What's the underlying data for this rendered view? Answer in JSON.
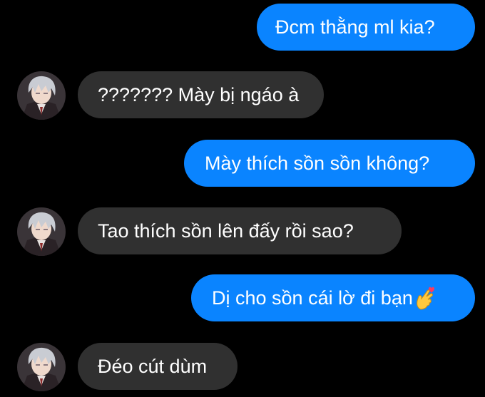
{
  "conversation": {
    "colors": {
      "background": "#000000",
      "outgoing_bubble": "#0a84ff",
      "incoming_bubble": "#303030",
      "text": "#ffffff"
    },
    "messages": [
      {
        "direction": "outgoing",
        "text": "Đcm thằng ml kia?"
      },
      {
        "direction": "incoming",
        "text": "??????? Mày bị ngáo à",
        "avatar": "anime-avatar"
      },
      {
        "direction": "outgoing",
        "text": "Mày thích sồn sồn không?"
      },
      {
        "direction": "incoming",
        "text": "Tao thích sồn lên đấy rồi sao?",
        "avatar": "anime-avatar"
      },
      {
        "direction": "outgoing",
        "text": "Dị cho sồn cái lờ đi bạn",
        "emoji": "finger-heart-emoji"
      },
      {
        "direction": "incoming",
        "text": "Đéo cút dùm",
        "avatar": "anime-avatar"
      }
    ]
  }
}
